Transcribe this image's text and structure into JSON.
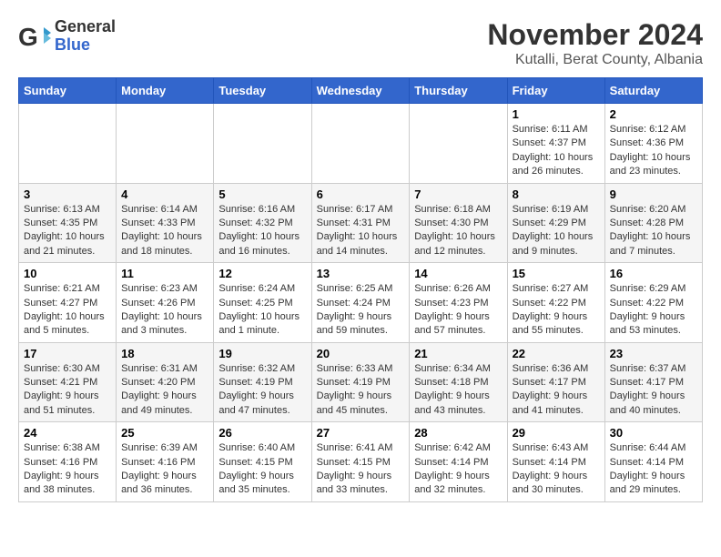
{
  "logo": {
    "line1": "General",
    "line2": "Blue"
  },
  "title": "November 2024",
  "subtitle": "Kutalli, Berat County, Albania",
  "days_of_week": [
    "Sunday",
    "Monday",
    "Tuesday",
    "Wednesday",
    "Thursday",
    "Friday",
    "Saturday"
  ],
  "weeks": [
    [
      {
        "day": "",
        "info": ""
      },
      {
        "day": "",
        "info": ""
      },
      {
        "day": "",
        "info": ""
      },
      {
        "day": "",
        "info": ""
      },
      {
        "day": "",
        "info": ""
      },
      {
        "day": "1",
        "info": "Sunrise: 6:11 AM\nSunset: 4:37 PM\nDaylight: 10 hours and 26 minutes."
      },
      {
        "day": "2",
        "info": "Sunrise: 6:12 AM\nSunset: 4:36 PM\nDaylight: 10 hours and 23 minutes."
      }
    ],
    [
      {
        "day": "3",
        "info": "Sunrise: 6:13 AM\nSunset: 4:35 PM\nDaylight: 10 hours and 21 minutes."
      },
      {
        "day": "4",
        "info": "Sunrise: 6:14 AM\nSunset: 4:33 PM\nDaylight: 10 hours and 18 minutes."
      },
      {
        "day": "5",
        "info": "Sunrise: 6:16 AM\nSunset: 4:32 PM\nDaylight: 10 hours and 16 minutes."
      },
      {
        "day": "6",
        "info": "Sunrise: 6:17 AM\nSunset: 4:31 PM\nDaylight: 10 hours and 14 minutes."
      },
      {
        "day": "7",
        "info": "Sunrise: 6:18 AM\nSunset: 4:30 PM\nDaylight: 10 hours and 12 minutes."
      },
      {
        "day": "8",
        "info": "Sunrise: 6:19 AM\nSunset: 4:29 PM\nDaylight: 10 hours and 9 minutes."
      },
      {
        "day": "9",
        "info": "Sunrise: 6:20 AM\nSunset: 4:28 PM\nDaylight: 10 hours and 7 minutes."
      }
    ],
    [
      {
        "day": "10",
        "info": "Sunrise: 6:21 AM\nSunset: 4:27 PM\nDaylight: 10 hours and 5 minutes."
      },
      {
        "day": "11",
        "info": "Sunrise: 6:23 AM\nSunset: 4:26 PM\nDaylight: 10 hours and 3 minutes."
      },
      {
        "day": "12",
        "info": "Sunrise: 6:24 AM\nSunset: 4:25 PM\nDaylight: 10 hours and 1 minute."
      },
      {
        "day": "13",
        "info": "Sunrise: 6:25 AM\nSunset: 4:24 PM\nDaylight: 9 hours and 59 minutes."
      },
      {
        "day": "14",
        "info": "Sunrise: 6:26 AM\nSunset: 4:23 PM\nDaylight: 9 hours and 57 minutes."
      },
      {
        "day": "15",
        "info": "Sunrise: 6:27 AM\nSunset: 4:22 PM\nDaylight: 9 hours and 55 minutes."
      },
      {
        "day": "16",
        "info": "Sunrise: 6:29 AM\nSunset: 4:22 PM\nDaylight: 9 hours and 53 minutes."
      }
    ],
    [
      {
        "day": "17",
        "info": "Sunrise: 6:30 AM\nSunset: 4:21 PM\nDaylight: 9 hours and 51 minutes."
      },
      {
        "day": "18",
        "info": "Sunrise: 6:31 AM\nSunset: 4:20 PM\nDaylight: 9 hours and 49 minutes."
      },
      {
        "day": "19",
        "info": "Sunrise: 6:32 AM\nSunset: 4:19 PM\nDaylight: 9 hours and 47 minutes."
      },
      {
        "day": "20",
        "info": "Sunrise: 6:33 AM\nSunset: 4:19 PM\nDaylight: 9 hours and 45 minutes."
      },
      {
        "day": "21",
        "info": "Sunrise: 6:34 AM\nSunset: 4:18 PM\nDaylight: 9 hours and 43 minutes."
      },
      {
        "day": "22",
        "info": "Sunrise: 6:36 AM\nSunset: 4:17 PM\nDaylight: 9 hours and 41 minutes."
      },
      {
        "day": "23",
        "info": "Sunrise: 6:37 AM\nSunset: 4:17 PM\nDaylight: 9 hours and 40 minutes."
      }
    ],
    [
      {
        "day": "24",
        "info": "Sunrise: 6:38 AM\nSunset: 4:16 PM\nDaylight: 9 hours and 38 minutes."
      },
      {
        "day": "25",
        "info": "Sunrise: 6:39 AM\nSunset: 4:16 PM\nDaylight: 9 hours and 36 minutes."
      },
      {
        "day": "26",
        "info": "Sunrise: 6:40 AM\nSunset: 4:15 PM\nDaylight: 9 hours and 35 minutes."
      },
      {
        "day": "27",
        "info": "Sunrise: 6:41 AM\nSunset: 4:15 PM\nDaylight: 9 hours and 33 minutes."
      },
      {
        "day": "28",
        "info": "Sunrise: 6:42 AM\nSunset: 4:14 PM\nDaylight: 9 hours and 32 minutes."
      },
      {
        "day": "29",
        "info": "Sunrise: 6:43 AM\nSunset: 4:14 PM\nDaylight: 9 hours and 30 minutes."
      },
      {
        "day": "30",
        "info": "Sunrise: 6:44 AM\nSunset: 4:14 PM\nDaylight: 9 hours and 29 minutes."
      }
    ]
  ]
}
